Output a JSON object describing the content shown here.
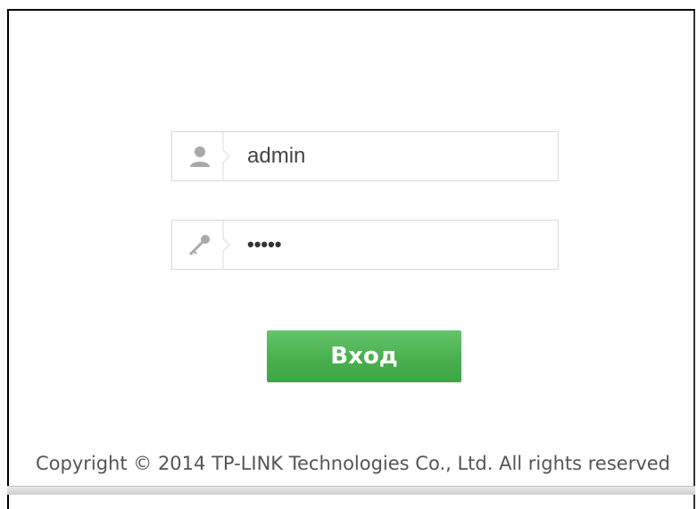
{
  "login": {
    "username_value": "admin",
    "password_mask": "•••••",
    "submit_label": "Вход"
  },
  "footer": {
    "copyright": "Copyright © 2014 TP-LINK Technologies Co., Ltd. All rights reserved"
  },
  "icons": {
    "username": "user-icon",
    "password": "key-icon"
  },
  "colors": {
    "button": "#4cb152",
    "border": "#d9d9d9",
    "icon": "#a8a8a8"
  }
}
